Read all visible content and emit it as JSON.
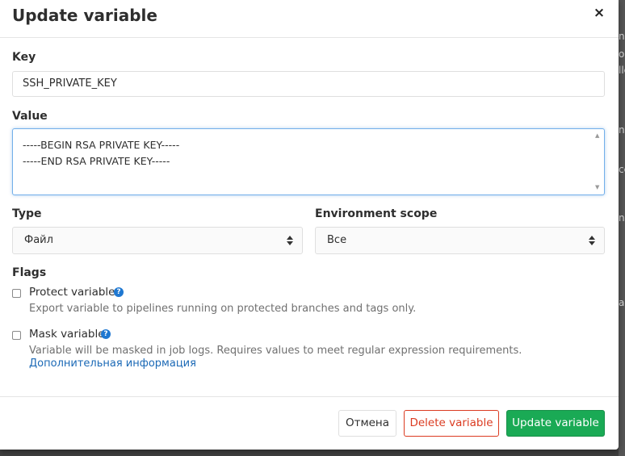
{
  "backdrop": {
    "fragments": [
      "na",
      "ou",
      "lle",
      "nt",
      "ce",
      "ne",
      "a"
    ]
  },
  "modal": {
    "title": "Update variable",
    "close_glyph": "×"
  },
  "form": {
    "key": {
      "label": "Key",
      "value": "SSH_PRIVATE_KEY"
    },
    "value": {
      "label": "Value",
      "lines": [
        "-----BEGIN RSA PRIVATE KEY-----",
        "-----END RSA PRIVATE KEY-----"
      ]
    },
    "type": {
      "label": "Type",
      "selected": "Файл"
    },
    "scope": {
      "label": "Environment scope",
      "selected": "Все"
    },
    "flags": {
      "label": "Flags",
      "protect": {
        "label": "Protect variable",
        "checked": false,
        "help": "Export variable to pipelines running on protected branches and tags only."
      },
      "mask": {
        "label": "Mask variable",
        "checked": false,
        "help": "Variable will be masked in job logs. Requires values to meet regular expression requirements.",
        "more_link": "Дополнительная информация"
      },
      "help_glyph": "?"
    }
  },
  "footer": {
    "cancel_label": "Отмена",
    "delete_label": "Delete variable",
    "update_label": "Update variable"
  },
  "colors": {
    "primary_green": "#1aaa55",
    "danger_red": "#db3b21",
    "link_blue": "#1b69b6",
    "focus_blue": "#73afea",
    "help_blue": "#1f78d1"
  }
}
